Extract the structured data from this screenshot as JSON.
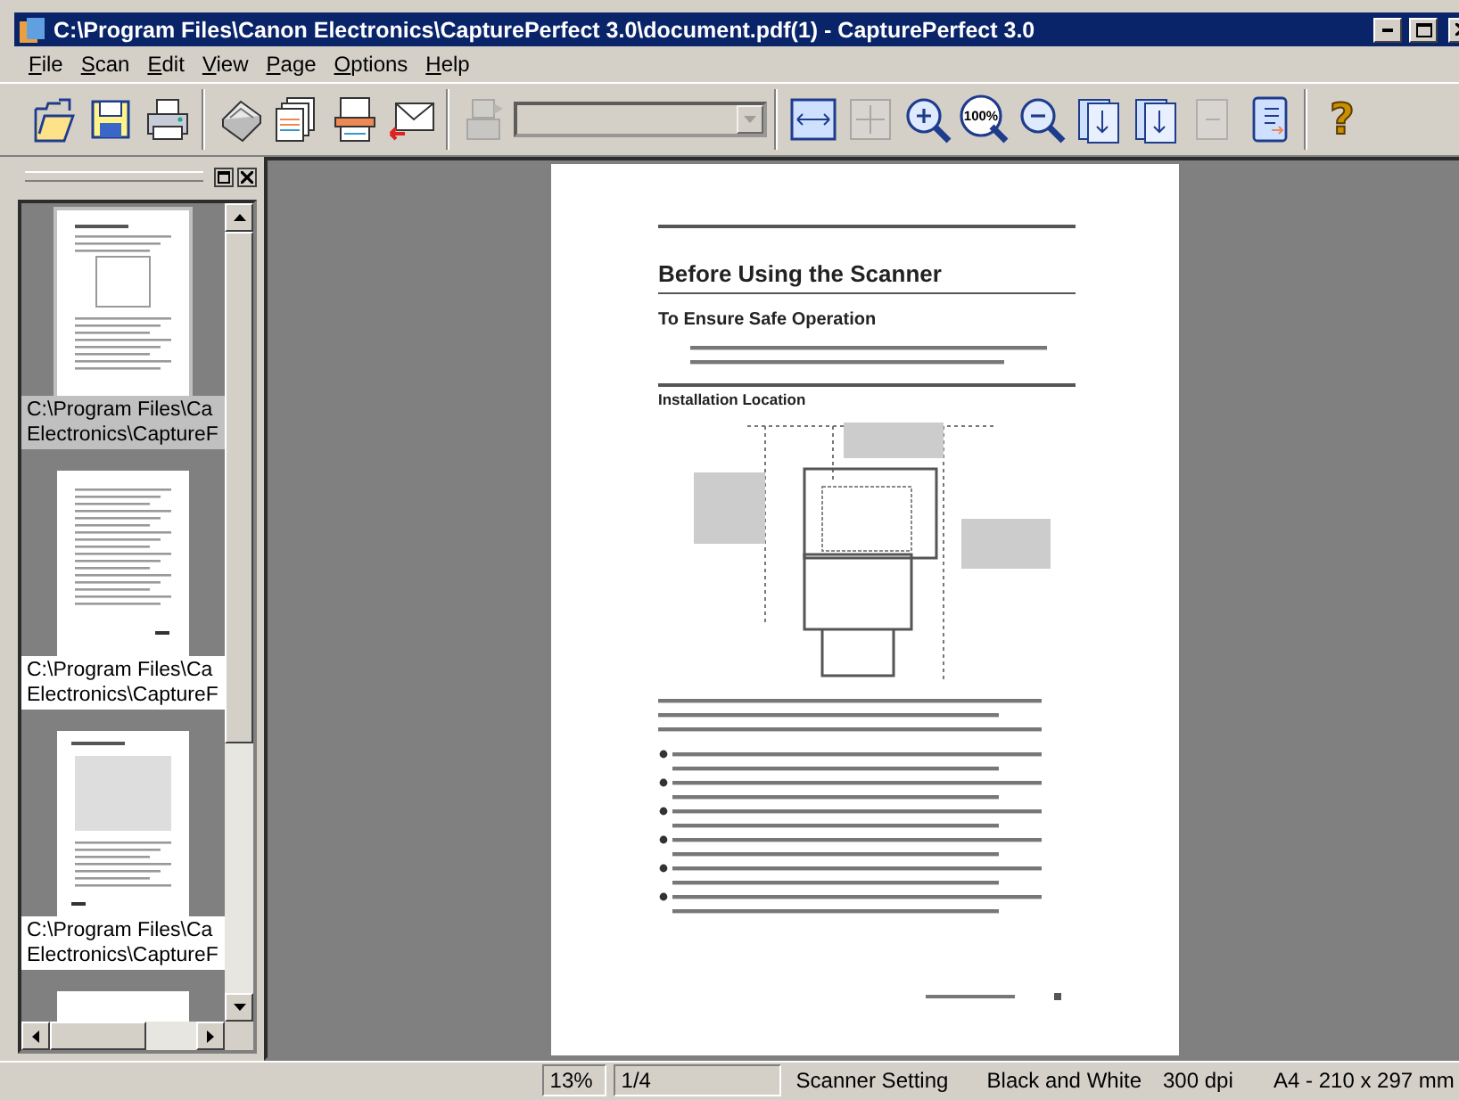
{
  "window": {
    "title": "C:\\Program Files\\Canon Electronics\\CapturePerfect 3.0\\document.pdf(1) - CapturePerfect 3.0"
  },
  "menu": [
    {
      "label": "File"
    },
    {
      "label": "Scan"
    },
    {
      "label": "Edit"
    },
    {
      "label": "View"
    },
    {
      "label": "Page"
    },
    {
      "label": "Options"
    },
    {
      "label": "Help"
    }
  ],
  "toolbar": [
    {
      "kind": "open",
      "disabled": false
    },
    {
      "kind": "save",
      "disabled": false
    },
    {
      "kind": "print",
      "disabled": false
    },
    {
      "kind": "sep"
    },
    {
      "kind": "scanner",
      "disabled": false
    },
    {
      "kind": "batch",
      "disabled": false
    },
    {
      "kind": "page",
      "disabled": false
    },
    {
      "kind": "mail",
      "disabled": false
    },
    {
      "kind": "sep"
    },
    {
      "kind": "job",
      "disabled": true
    },
    {
      "kind": "combo",
      "disabled": true
    },
    {
      "kind": "sep"
    },
    {
      "kind": "fitwidth",
      "disabled": false
    },
    {
      "kind": "fitpage",
      "disabled": true
    },
    {
      "kind": "zoomin",
      "disabled": false
    },
    {
      "kind": "zoom100",
      "disabled": false,
      "label": "100%"
    },
    {
      "kind": "zoomout",
      "disabled": false
    },
    {
      "kind": "insert",
      "disabled": false
    },
    {
      "kind": "insert",
      "disabled": false
    },
    {
      "kind": "extract",
      "disabled": true
    },
    {
      "kind": "book",
      "disabled": false
    },
    {
      "kind": "sep"
    },
    {
      "kind": "help",
      "disabled": false,
      "label": "?"
    }
  ],
  "thumbnails": [
    {
      "caption_lines": [
        "C:\\Program Files\\Ca",
        "Electronics\\CaptureF"
      ],
      "selected": true,
      "kind": "text"
    },
    {
      "caption_lines": [
        "C:\\Program Files\\Ca",
        "Electronics\\CaptureF"
      ],
      "selected": false,
      "kind": "list"
    },
    {
      "caption_lines": [
        "C:\\Program Files\\Ca",
        "Electronics\\CaptureF"
      ],
      "selected": false,
      "kind": "figure"
    },
    {
      "selected": false,
      "kind": "blank"
    }
  ],
  "document": {
    "heading": "Before Using the Scanner",
    "subheading": "To Ensure Safe Operation",
    "section": "Installation Location"
  },
  "status_bar": [
    {
      "text": "13%",
      "kind": "sunken"
    },
    {
      "text": "1/4",
      "kind": "sunken"
    },
    {
      "text": "Scanner Setting",
      "kind": "flat"
    },
    {
      "text": "Black and White",
      "kind": "flat"
    },
    {
      "text": "300 dpi",
      "kind": "flat"
    },
    {
      "text": "A4 - 210 x 297 mm",
      "kind": "flat"
    }
  ]
}
